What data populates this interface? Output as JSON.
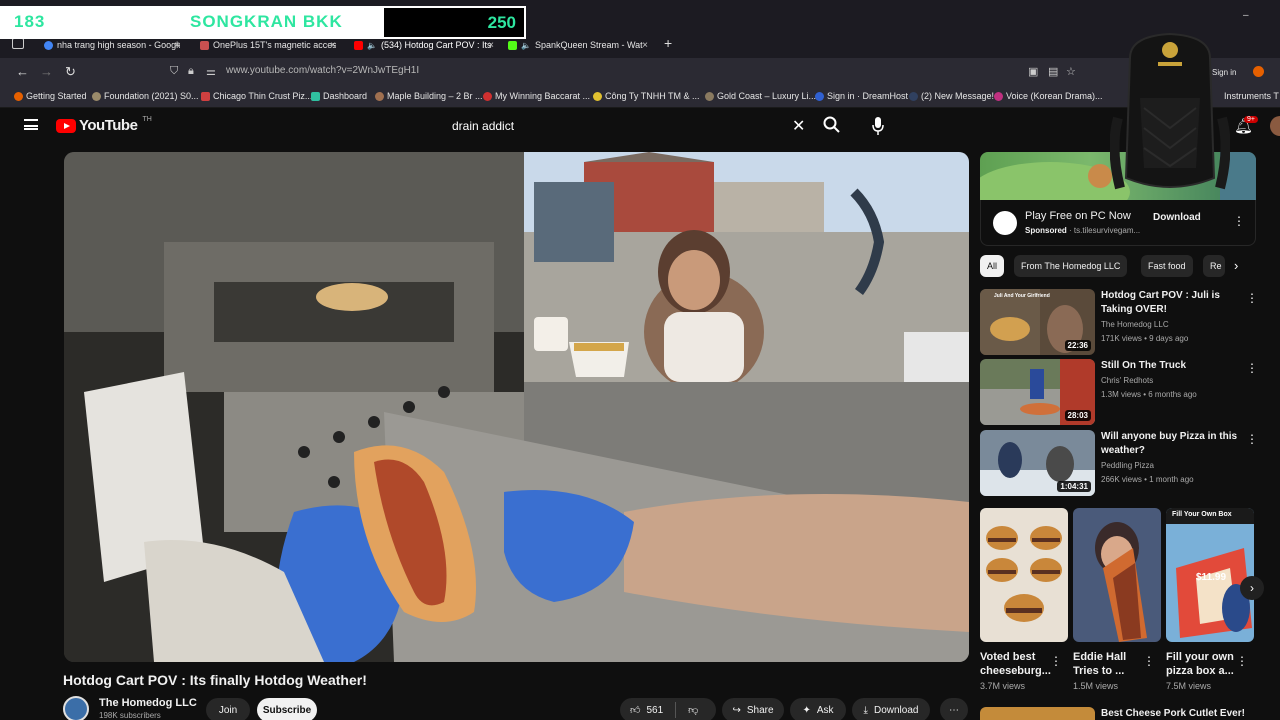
{
  "overlay": {
    "left_score": "183",
    "event": "SONGKRAN BKK",
    "right_score": "250"
  },
  "tabs": [
    {
      "label": "nha trang high season - Google",
      "icon": "google-icon",
      "color": "#4285f4"
    },
    {
      "label": "OnePlus 15T's magnetic access",
      "icon": "page-icon",
      "color": "#c85050"
    },
    {
      "label": "(534) Hotdog Cart POV : Its",
      "icon": "youtube-icon",
      "color": "#ff0000"
    },
    {
      "label": "SpankQueen Stream - Wat",
      "icon": "kick-icon",
      "color": "#53fc18"
    }
  ],
  "address": {
    "url": "www.youtube.com/watch?v=2WnJwTEgH1I",
    "sign_in": "Sign in"
  },
  "bookmarks": [
    "Getting Started",
    "Foundation (2021) S0...",
    "Chicago Thin Crust Piz...",
    "Dashboard",
    "Maple Building – 2 Br ...",
    "My Winning Baccarat ...",
    "Công Ty TNHH TM & ...",
    "Gold Coast – Luxury Li...",
    "Sign in · DreamHost",
    "(2) New Message!",
    "Voice (Korean Drama)...",
    "Instruments T"
  ],
  "youtube": {
    "logo": "YouTube",
    "country": "TH",
    "search_value": "drain addict",
    "notification_count": "9+"
  },
  "video": {
    "title": "Hotdog Cart POV : Its finally Hotdog Weather!",
    "channel": "The Homedog LLC",
    "subscribers": "198K subscribers",
    "join": "Join",
    "subscribe": "Subscribe",
    "likes": "561",
    "share": "Share",
    "ask": "Ask",
    "download": "Download"
  },
  "ad": {
    "title": "Play Free on PC Now",
    "sponsored": "Sponsored",
    "domain": "· ts.tilesurvivegam...",
    "cta": "Download"
  },
  "chips": [
    "All",
    "From The Homedog LLC",
    "Fast food",
    "Re"
  ],
  "recommendations": [
    {
      "title": "Hotdog Cart POV : Juli is Taking OVER!",
      "channel": "The Homedog LLC",
      "meta": "171K views • 9 days ago",
      "duration": "22:36",
      "thumb_overlay": "Juli And Your Girlfriend"
    },
    {
      "title": "Still On The Truck",
      "channel": "Chris' Redhots",
      "meta": "1.3M views • 6 months ago",
      "duration": "28:03"
    },
    {
      "title": "Will anyone buy Pizza in this weather?",
      "channel": "Peddling Pizza",
      "meta": "266K views • 1 month ago",
      "duration": "1:04:31"
    }
  ],
  "shorts": [
    {
      "title": "Voted best cheeseburg...",
      "views": "3.7M views"
    },
    {
      "title": "Eddie Hall Tries to ...",
      "views": "1.5M views"
    },
    {
      "title": "Fill your own pizza box a...",
      "views": "7.5M views",
      "thumb_header": "Fill Your Own Box",
      "thumb_price": "$11.99"
    }
  ],
  "bottom_rec_title": "Best Cheese Pork Cutlet Ever!"
}
